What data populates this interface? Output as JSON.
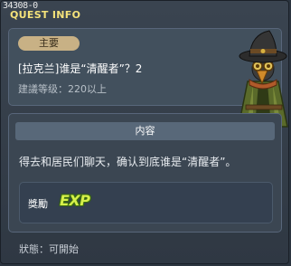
{
  "window": {
    "quest_id": "34308-0",
    "title": "QUEST INFO"
  },
  "quest": {
    "badge": "主要",
    "name": "[拉克兰]谁是“清醒者”？2",
    "level": "建議等级：220以上"
  },
  "content": {
    "header": "内容",
    "description": "得去和居民们聊天，确认到底谁是“清醒者”。"
  },
  "reward": {
    "label": "獎勵",
    "exp_label": "EXP"
  },
  "status": {
    "text": "狀態：可開始"
  },
  "npc": {
    "icon": "hooded-bird-npc-icon"
  }
}
